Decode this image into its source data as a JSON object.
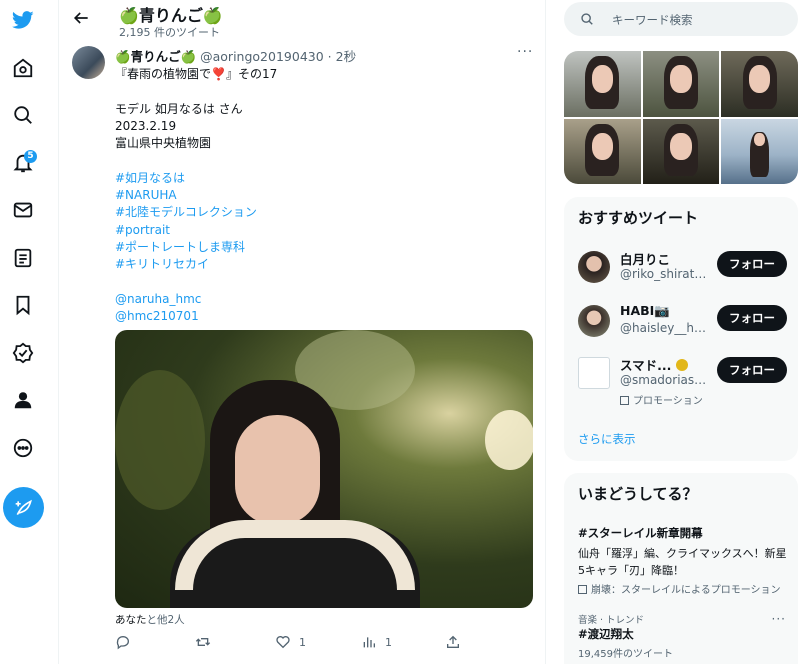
{
  "nav": {
    "notifications_badge": "5"
  },
  "header": {
    "title": "🍏青りんご🍏",
    "subtitle": "2,195 件のツイート"
  },
  "tweet": {
    "name": "🍏青りんご🍏",
    "handle": "@aoringo20190430",
    "dot": "·",
    "time": "2秒",
    "more": "···",
    "lines": [
      "『春雨の植物園で❣️』その17",
      "",
      "モデル 如月なるは さん",
      "2023.2.19",
      "富山県中央植物園",
      "",
      "#如月なるは",
      "#NARUHA",
      "#北陸モデルコレクション",
      "#portrait",
      "#ポートレートしま専科",
      "#キリトリセカイ",
      "",
      "@naruha_hmc",
      "@hmc210701"
    ],
    "liked_by": "あなた",
    "liked_rest": "と他2人",
    "like_count": "1",
    "view_count": "1"
  },
  "search": {
    "placeholder": "キーワード検索"
  },
  "recommend": {
    "title": "おすすめツイート",
    "follow_label": "フォロー",
    "users": [
      {
        "name": "白月りこ",
        "handle": "@riko_shiratsuki"
      },
      {
        "name": "HABI📷",
        "handle": "@haisley__habi"
      },
      {
        "name": "スマド...",
        "handle": "@smadoriasahi",
        "promo": "プロモーション"
      }
    ],
    "show_more": "さらに表示"
  },
  "trends": {
    "title": "いまどうしてる？",
    "items": [
      {
        "title": "#スターレイル新章開幕",
        "desc": "仙舟「羅浮」編、クライマックスへ！新星5キャラ「刃」降臨！",
        "promo": "崩壊：スターレイルによるプロモーション"
      },
      {
        "category": "音楽 · トレンド",
        "title": "#渡辺翔太",
        "count": "19,459件のツイート"
      }
    ],
    "more": "···"
  },
  "colors": {
    "accent": "#1d9bf0",
    "text": "#0f1419",
    "muted": "#536471"
  }
}
